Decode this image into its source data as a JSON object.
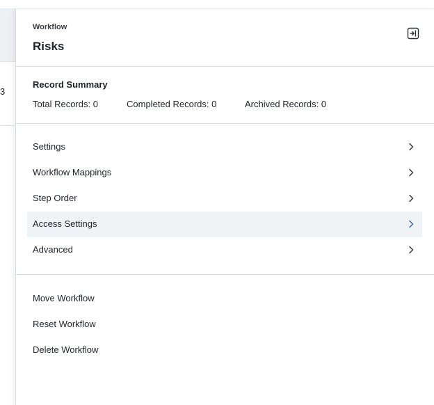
{
  "background": {
    "text_fragment": "3"
  },
  "drawer": {
    "eyebrow": "Workflow",
    "title": "Risks",
    "collapse_icon": "panel-collapse-icon"
  },
  "summary": {
    "title": "Record Summary",
    "total": "Total Records: 0",
    "completed": "Completed Records: 0",
    "archived": "Archived Records: 0"
  },
  "menu": {
    "items": [
      {
        "label": "Settings",
        "icon": "chevron-right-icon"
      },
      {
        "label": "Workflow Mappings",
        "icon": "chevron-right-icon"
      },
      {
        "label": "Step Order",
        "icon": "chevron-right-icon"
      },
      {
        "label": "Access Settings",
        "icon": "chevron-right-icon",
        "active": true
      },
      {
        "label": "Advanced",
        "icon": "chevron-right-icon"
      }
    ]
  },
  "actions": {
    "move": "Move Workflow",
    "reset": "Reset Workflow",
    "delete": "Delete Workflow"
  },
  "colors": {
    "active_row_bg": "#f0f3f6",
    "active_chevron": "#2f5ea8",
    "divider": "#d8dce1"
  }
}
